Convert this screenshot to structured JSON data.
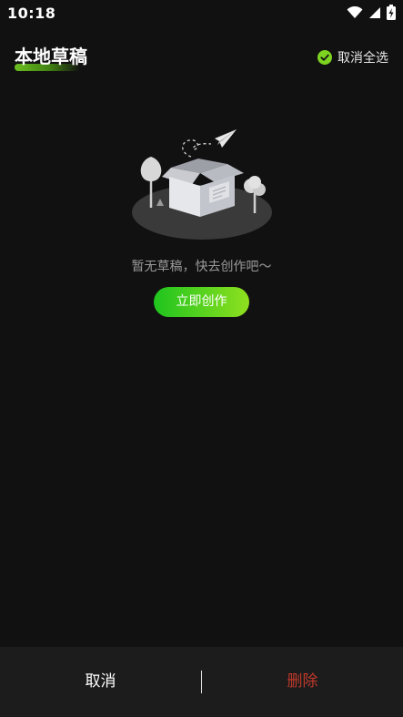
{
  "status_bar": {
    "time": "10:18",
    "icons": [
      "wifi-icon",
      "signal-icon",
      "battery-icon"
    ]
  },
  "header": {
    "title": "本地草稿",
    "select_all_label": "取消全选",
    "select_icon": "check-circle-icon"
  },
  "empty_state": {
    "illustration": "open-box-paper-plane-illustration",
    "message": "暂无草稿，快去创作吧～",
    "create_label": "立即创作"
  },
  "bottom_bar": {
    "cancel_label": "取消",
    "delete_label": "删除"
  },
  "colors": {
    "background": "#111111",
    "accent_green": "#7ed321",
    "delete_red": "#c0392b",
    "bottom_bar": "#1c1c1c"
  }
}
